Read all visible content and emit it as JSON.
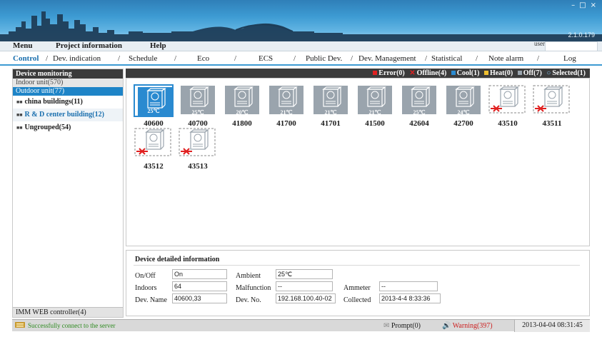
{
  "app": {
    "version": "2.1.0.179",
    "user": "user",
    "window_controls": [
      "–",
      "□",
      "×"
    ]
  },
  "menu": [
    "Menu",
    "Project information",
    "Help"
  ],
  "tabs": [
    "Control",
    "Dev. indication",
    "Schedule",
    "Eco",
    "ECS",
    "Public Dev.",
    "Dev. Management",
    "Statistical",
    "Note alarm",
    "Log"
  ],
  "sidebar": {
    "header": "Device monitoring",
    "indoor": "Indoor unit(570)",
    "outdoor": "Outdoor unit(77)",
    "groups": [
      "china buildings(11)",
      "R & D center building(12)",
      "Ungrouped(54)"
    ],
    "footer": "IMM WEB controller(4)"
  },
  "legend": {
    "title": "Device monitoring",
    "items": [
      {
        "label": "Error(0)",
        "color": "#e02020",
        "shape": "square"
      },
      {
        "label": "Offline(4)",
        "color": "#e02020",
        "shape": "cross"
      },
      {
        "label": "Cool(1)",
        "color": "#2a8ad0",
        "shape": "square"
      },
      {
        "label": "Heat(0)",
        "color": "#f0c030",
        "shape": "square"
      },
      {
        "label": "Off(7)",
        "color": "#9aa4ad",
        "shape": "square"
      },
      {
        "label": "Selected(1)",
        "color": "#2a8ad0",
        "shape": "ring"
      }
    ]
  },
  "units": [
    {
      "id": "40600",
      "temp": "25℃",
      "state": "cool",
      "selected": true
    },
    {
      "id": "40700",
      "temp": "25℃",
      "state": "off",
      "selected": false
    },
    {
      "id": "41800",
      "temp": "20℃",
      "state": "off",
      "selected": false
    },
    {
      "id": "41700",
      "temp": "21℃",
      "state": "off",
      "selected": false
    },
    {
      "id": "41701",
      "temp": "21℃",
      "state": "off",
      "selected": false
    },
    {
      "id": "41500",
      "temp": "21℃",
      "state": "off",
      "selected": false
    },
    {
      "id": "42604",
      "temp": "25℃",
      "state": "off",
      "selected": false
    },
    {
      "id": "42700",
      "temp": "24℃",
      "state": "off",
      "selected": false
    },
    {
      "id": "43510",
      "temp": "",
      "state": "offline",
      "selected": false
    },
    {
      "id": "43511",
      "temp": "",
      "state": "offline",
      "selected": false
    },
    {
      "id": "43512",
      "temp": "",
      "state": "offline",
      "selected": false
    },
    {
      "id": "43513",
      "temp": "",
      "state": "offline",
      "selected": false
    }
  ],
  "details": {
    "title": "Device detailed information",
    "onoff_label": "On/Off",
    "onoff": "On",
    "ambient_label": "Ambient",
    "ambient": "25℃",
    "indoors_label": "Indoors",
    "indoors": "64",
    "malfunction_label": "Malfunction",
    "malfunction": "--",
    "ammeter_label": "Ammeter",
    "ammeter": "--",
    "devname_label": "Dev. Name",
    "devname": "40600,33",
    "devno_label": "Dev. No.",
    "devno": "192.168.100.40-02",
    "collected_label": "Collected",
    "collected": "2013-4-4 8:33:36"
  },
  "status": {
    "message": "Successfully connect to the server",
    "prompt": "Prompt(0)",
    "warning": "Warning(397)",
    "time": "2013-04-04 08:31:45"
  }
}
